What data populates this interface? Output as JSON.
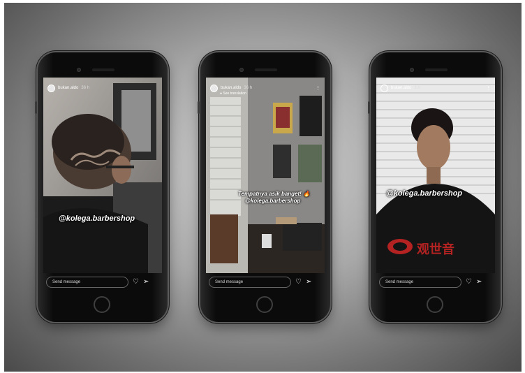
{
  "phones": [
    {
      "username": "bukan.aldo",
      "time": "36 h",
      "caption": "@kolega.barbershop",
      "message_placeholder": "Send message"
    },
    {
      "username": "bukan.aldo",
      "time": "36 h",
      "see_translation": "See translation",
      "caption_line1": "Tempatnya asik banget! 🔥",
      "caption_line2": "@kolega.barbershop",
      "message_placeholder": "Send message"
    },
    {
      "username": "bukan.aldo",
      "time": "3 h",
      "caption": "@kolega.barbershop",
      "shirt_text": "观世音",
      "message_placeholder": "Send message"
    }
  ],
  "icons": {
    "more": "more-icon",
    "heart": "heart-icon",
    "send": "send-icon"
  }
}
